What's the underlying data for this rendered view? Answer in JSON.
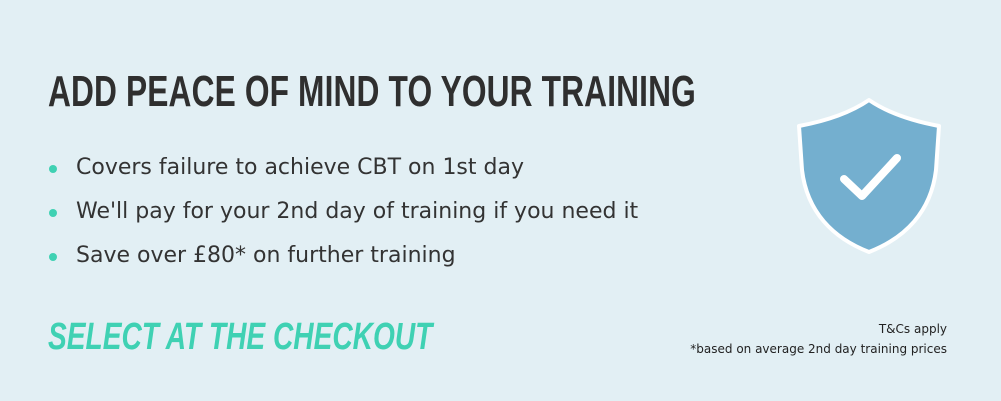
{
  "headline": "ADD PEACE OF MIND TO YOUR TRAINING",
  "benefits": [
    "Covers failure to achieve CBT on 1st day",
    "We'll pay for your 2nd day of training if you need it",
    "Save over £80* on further training"
  ],
  "cta": "SELECT AT THE CHECKOUT",
  "terms": {
    "apply": "T&Cs apply",
    "note": "*based on average 2nd day training prices"
  },
  "icon": "shield-check-icon",
  "colors": {
    "background": "#e2eff4",
    "accent": "#3fd1b3",
    "shield_fill": "#74afcf",
    "text": "#2f2f2f"
  }
}
